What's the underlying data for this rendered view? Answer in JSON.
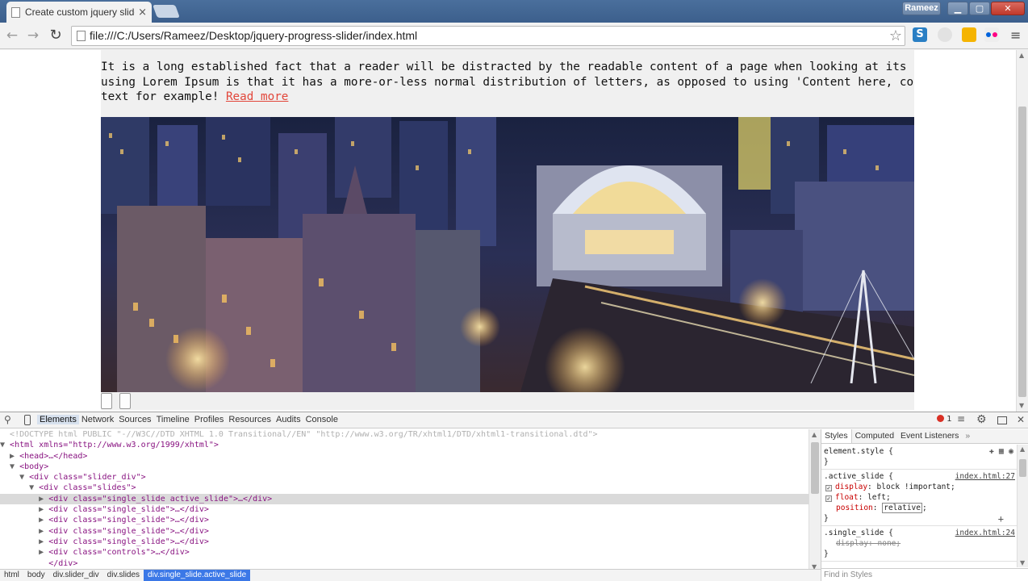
{
  "browser": {
    "tab_title": "Create custom jquery slide",
    "tab_close": "×",
    "profile_name": "Rameez",
    "url": "file:///C:/Users/Rameez/Desktop/jquery-progress-slider/index.html",
    "icons": {
      "back": "←",
      "forward": "→",
      "reload": "↻",
      "star": "☆",
      "minimize": "▁",
      "maximize": "▢",
      "close": "✕",
      "menu": "≡",
      "ext_s": "S"
    }
  },
  "page": {
    "paragraph_lines": [
      "It is a long established fact that a reader will be distracted by the readable content of a page when looking at its layout",
      "using Lorem Ipsum is that it has a more-or-less normal distribution of letters, as opposed to using 'Content here, content",
      "text for example! "
    ],
    "read_more": "Read more",
    "link_color": "#e2473b"
  },
  "devtools": {
    "tabs": [
      "Elements",
      "Network",
      "Sources",
      "Timeline",
      "Profiles",
      "Resources",
      "Audits",
      "Console"
    ],
    "active_tab": "Elements",
    "error_count": "1",
    "more_icon": "»",
    "dom_lines": [
      {
        "indent": "",
        "tri": "",
        "text": "<!DOCTYPE html PUBLIC \"-//W3C//DTD XHTML 1.0 Transitional//EN\" \"http://www.w3.org/TR/xhtml1/DTD/xhtml1-transitional.dtd\">",
        "kind": "doctype"
      },
      {
        "indent": "",
        "tri": "▼",
        "text": "<html xmlns=\"http://www.w3.org/1999/xhtml\">",
        "kind": "tag"
      },
      {
        "indent": "  ",
        "tri": "▶",
        "text": "<head>…</head>",
        "kind": "tag"
      },
      {
        "indent": "  ",
        "tri": "▼",
        "text": "<body>",
        "kind": "tag"
      },
      {
        "indent": "    ",
        "tri": "▼",
        "text": "<div class=\"slider_div\">",
        "kind": "tag"
      },
      {
        "indent": "      ",
        "tri": "▼",
        "text": "<div class=\"slides\">",
        "kind": "tag"
      },
      {
        "indent": "        ",
        "tri": "▶",
        "text": "<div class=\"single_slide active_slide\">…</div>",
        "kind": "selected"
      },
      {
        "indent": "        ",
        "tri": "▶",
        "text": "<div class=\"single_slide\">…</div>",
        "kind": "tag"
      },
      {
        "indent": "        ",
        "tri": "▶",
        "text": "<div class=\"single_slide\">…</div>",
        "kind": "tag"
      },
      {
        "indent": "        ",
        "tri": "▶",
        "text": "<div class=\"single_slide\">…</div>",
        "kind": "tag"
      },
      {
        "indent": "        ",
        "tri": "▶",
        "text": "<div class=\"single_slide\">…</div>",
        "kind": "tag"
      },
      {
        "indent": "        ",
        "tri": "▶",
        "text": "<div class=\"controls\">…</div>",
        "kind": "tag"
      },
      {
        "indent": "        ",
        "tri": "",
        "text": "</div>",
        "kind": "tag"
      }
    ],
    "breadcrumbs": [
      "html",
      "body",
      "div.slider_div",
      "div.slides",
      "div.single_slide.active_slide"
    ],
    "styles_tabs": [
      "Styles",
      "Computed",
      "Event Listeners"
    ],
    "styles": {
      "element_style_selector": "element.style {",
      "element_style_close": "}",
      "active_rule": {
        "selector": ".active_slide {",
        "source": "index.html:27",
        "props": [
          {
            "name": "display",
            "value": "block !important;",
            "checked": true
          },
          {
            "name": "float",
            "value": "left;",
            "checked": true
          }
        ],
        "editing_name": "position",
        "editing_value": "relative",
        "close": "}"
      },
      "single_rule": {
        "selector": ".single_slide {",
        "source": "index.html:24",
        "prop_name": "display",
        "prop_value": "none;",
        "close": "}"
      }
    },
    "find_placeholder": "Find in Styles"
  }
}
